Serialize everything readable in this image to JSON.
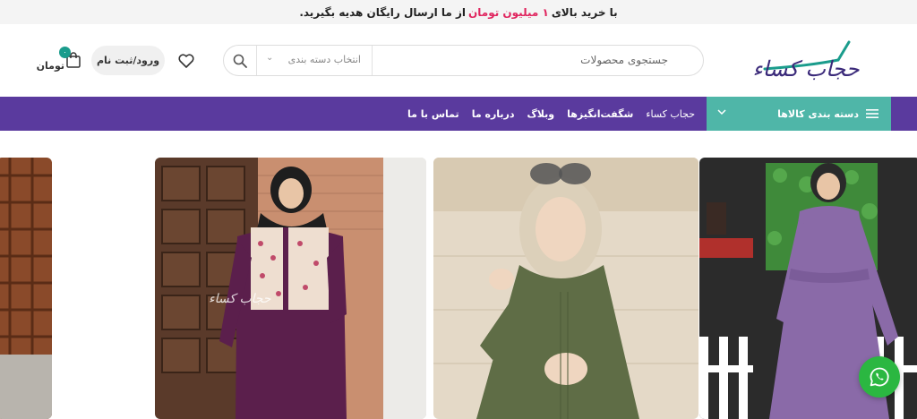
{
  "promo": {
    "prefix": "با خرید بالای",
    "highlight": "۱ میلیون تومان",
    "suffix": "از ما ارسال رایگان هدیه بگیرید."
  },
  "header": {
    "logo_text": "حجاب کساء",
    "search_placeholder": "جستجوی محصولات",
    "category_select": "انتخاب دسته بندی",
    "login_label": "ورود/ثبت نام",
    "cart_badge": "۰",
    "cart_amount": "۰ تومان"
  },
  "nav": {
    "categories_label": "دسته بندی کالاها",
    "links": [
      "حجاب کساء",
      "شگفت‌انگیزها",
      "وبلاگ",
      "درباره ما",
      "تماس با ما"
    ]
  },
  "colors": {
    "nav_bg": "#5a3a9e",
    "category_bg": "#4fb6a8",
    "promo_highlight": "#e0245e",
    "whatsapp": "#2bb741"
  },
  "icons": [
    "search-icon",
    "heart-icon",
    "cart-icon",
    "menu-icon",
    "chevron-down-icon",
    "whatsapp-icon"
  ]
}
